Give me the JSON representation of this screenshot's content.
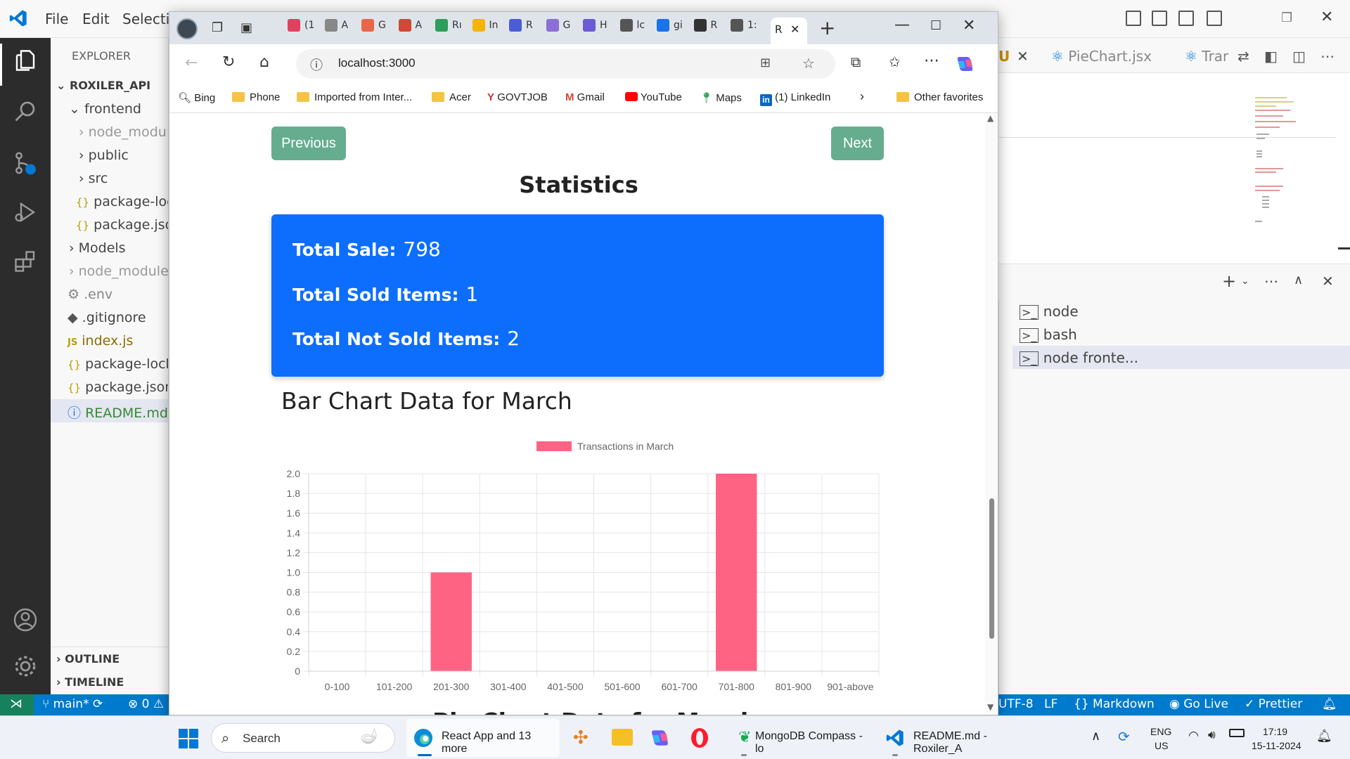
{
  "vscode": {
    "menu": [
      "File",
      "Edit",
      "Selectio"
    ],
    "explorer_title": "EXPLORER",
    "tree": [
      {
        "label": "ROXILER_API",
        "kind": "root"
      },
      {
        "label": "frontend",
        "kind": "folder-open"
      },
      {
        "label": "node_modu",
        "kind": "folder"
      },
      {
        "label": "public",
        "kind": "folder"
      },
      {
        "label": "src",
        "kind": "folder"
      },
      {
        "label": "package-loc",
        "kind": "json"
      },
      {
        "label": "package.jsor",
        "kind": "json"
      },
      {
        "label": "Models",
        "kind": "folder"
      },
      {
        "label": "node_module",
        "kind": "folder"
      },
      {
        "label": ".env",
        "kind": "gear"
      },
      {
        "label": ".gitignore",
        "kind": "git"
      },
      {
        "label": "index.js",
        "kind": "js"
      },
      {
        "label": "package-lock",
        "kind": "json"
      },
      {
        "label": "package.json",
        "kind": "json"
      },
      {
        "label": "README.md",
        "kind": "info"
      }
    ],
    "outline_label": "OUTLINE",
    "timeline_label": "TIMELINE",
    "editor_tab_u": "U",
    "editor_tab_piechart": "PieChart.jsx",
    "editor_tab_tran": "Trar",
    "terminals": [
      "node",
      "bash",
      "node fronte..."
    ],
    "status": {
      "branch": "main*",
      "errors": "0",
      "encoding": "UTF-8",
      "eol": "LF",
      "language": "Markdown",
      "golive": "Go Live",
      "prettier": "Prettier"
    }
  },
  "browser": {
    "tabs": [
      {
        "label": "(1",
        "color": "#e0415f"
      },
      {
        "label": "A",
        "color": "#888888"
      },
      {
        "label": "G",
        "color": "#e8674a"
      },
      {
        "label": "A",
        "color": "#d44638"
      },
      {
        "label": "Rı",
        "color": "#2e9e5b"
      },
      {
        "label": "In",
        "color": "#f4b400"
      },
      {
        "label": "R",
        "color": "#4c5cd6"
      },
      {
        "label": "G",
        "color": "#8c6fd6"
      },
      {
        "label": "H",
        "color": "#6b5bd6"
      },
      {
        "label": "lc",
        "color": "#555555"
      },
      {
        "label": "gi",
        "color": "#1a73e8"
      },
      {
        "label": "R",
        "color": "#333333"
      },
      {
        "label": "1:",
        "color": "#555555"
      }
    ],
    "active_tab_label": "R",
    "address": "localhost:3000",
    "bookmarks": [
      "Bing",
      "Phone",
      "Imported from Inter...",
      "Acer",
      "GOVTJOB",
      "Gmail",
      "YouTube",
      "Maps",
      "(1) LinkedIn",
      "Other favorites"
    ]
  },
  "page": {
    "prev_label": "Previous",
    "next_label": "Next",
    "stats_title": "Statistics",
    "total_sale_label": "Total Sale:",
    "total_sale_value": "798",
    "sold_label": "Total Sold Items:",
    "sold_value": "1",
    "not_sold_label": "Total Not Sold Items:",
    "not_sold_value": "2",
    "bar_title": "Bar Chart Data for March",
    "pie_title": "Pie Chart Data for March",
    "bar_color": "#ff6384"
  },
  "chart_data": {
    "type": "bar",
    "categories": [
      "0-100",
      "101-200",
      "201-300",
      "301-400",
      "401-500",
      "501-600",
      "601-700",
      "701-800",
      "801-900",
      "901-above"
    ],
    "series": [
      {
        "name": "Transactions in March",
        "values": [
          0,
          0,
          1,
          0,
          0,
          0,
          0,
          2,
          0,
          0
        ]
      }
    ],
    "ylim": [
      0,
      2.0
    ],
    "yticks": [
      "0",
      "0.2",
      "0.4",
      "0.6",
      "0.8",
      "1.0",
      "1.2",
      "1.4",
      "1.6",
      "1.8",
      "2.0"
    ],
    "grid": true,
    "legend": "top-center"
  },
  "taskbar": {
    "search_label": "Search",
    "edge_label": "React App and 13 more",
    "mongo_label": "MongoDB Compass - lo",
    "vscode_label": "README.md - Roxiler_A",
    "lang_1": "ENG",
    "lang_2": "US",
    "time": "17:19",
    "date": "15-11-2024"
  }
}
